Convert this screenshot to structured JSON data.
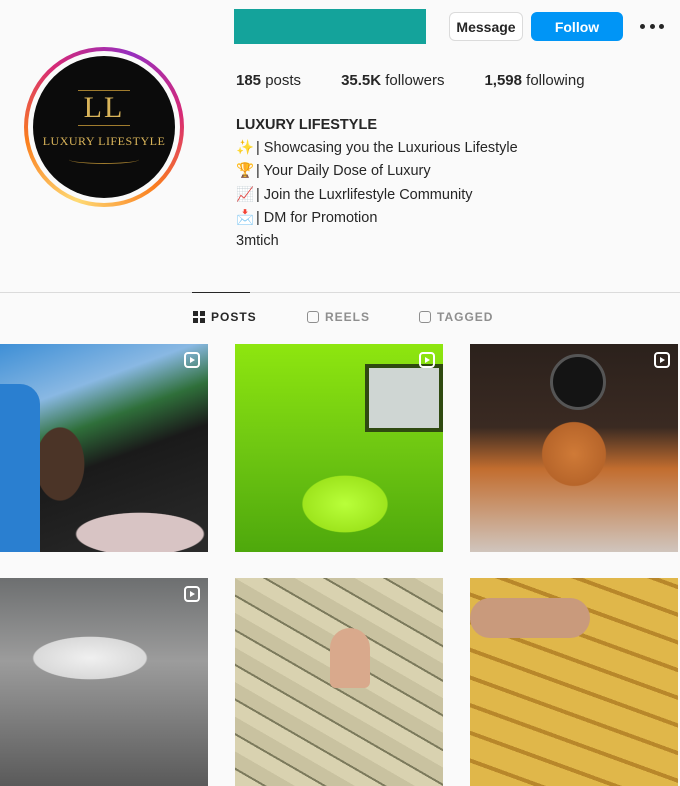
{
  "header": {
    "message_label": "Message",
    "follow_label": "Follow",
    "brand_color": "#14a39b",
    "follow_color": "#0095f6"
  },
  "avatar": {
    "monogram": "LL",
    "logo_text": "LUXURY LIFESTYLE"
  },
  "stats": {
    "posts_count": "185",
    "posts_label": "posts",
    "followers_count": "35.5K",
    "followers_label": "followers",
    "following_count": "1,598",
    "following_label": "following"
  },
  "bio": {
    "name": "LUXURY LIFESTYLE",
    "lines": [
      {
        "emoji": "✨",
        "text": "| Showcasing you the Luxurious Lifestyle"
      },
      {
        "emoji": "🏆",
        "text": "| Your Daily Dose of Luxury"
      },
      {
        "emoji": "📈",
        "text": "| Join the Luxrlifestyle Community"
      },
      {
        "emoji": "📩",
        "text": "| DM for Promotion"
      }
    ],
    "link": "3mtich"
  },
  "tabs": [
    {
      "label": "POSTS",
      "icon": "grid-icon",
      "active": true
    },
    {
      "label": "REELS",
      "icon": "reels-icon",
      "active": false
    },
    {
      "label": "TAGGED",
      "icon": "tagged-icon",
      "active": false
    }
  ],
  "posts": [
    {
      "subject": "woman-in-blue-convertible",
      "reel": true
    },
    {
      "subject": "lime-green-car-interior",
      "reel": true
    },
    {
      "subject": "bugatti-steering-wheel",
      "reel": true
    },
    {
      "subject": "silver-sports-car-garage",
      "reel": true
    },
    {
      "subject": "stacks-of-cash",
      "reel": false
    },
    {
      "subject": "gold-bars-in-hand",
      "reel": false
    }
  ]
}
